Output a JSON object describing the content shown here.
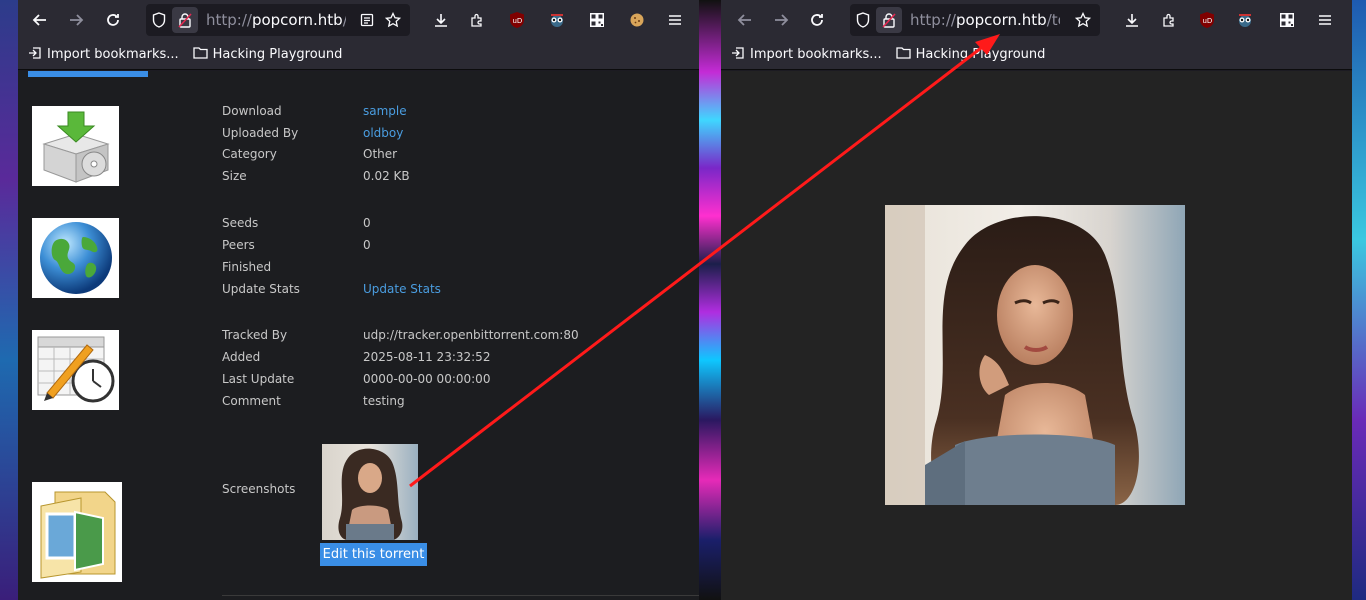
{
  "left_window": {
    "url_prefix": "http://",
    "url_host": "popcorn.htb",
    "url_path": "/t",
    "bookmarks": [
      "Import bookmarks...",
      "Hacking Playground"
    ],
    "details": [
      {
        "label": "Download",
        "value": "sample",
        "link": true
      },
      {
        "label": "Uploaded By",
        "value": "oldboy",
        "link": true
      },
      {
        "label": "Category",
        "value": "Other",
        "link": false
      },
      {
        "label": "Size",
        "value": "0.02 KB",
        "link": false
      }
    ],
    "stats": [
      {
        "label": "Seeds",
        "value": "0",
        "link": false
      },
      {
        "label": "Peers",
        "value": "0",
        "link": false
      },
      {
        "label": "Finished",
        "value": "",
        "link": false
      },
      {
        "label": "Update Stats",
        "value": "Update Stats",
        "link": true
      }
    ],
    "tracking": [
      {
        "label": "Tracked By",
        "value": "udp://tracker.openbittorrent.com:80"
      },
      {
        "label": "Added",
        "value": "2025-08-11 23:32:52"
      },
      {
        "label": "Last Update",
        "value": "0000-00-00 00:00:00"
      },
      {
        "label": "Comment",
        "value": "testing"
      }
    ],
    "screenshots_label": "Screenshots",
    "edit_button": "Edit this torrent"
  },
  "right_window": {
    "url_prefix": "http://",
    "url_host": "popcorn.htb",
    "url_path": "/tor",
    "bookmarks": [
      "Import bookmarks...",
      "Hacking Playground"
    ]
  },
  "colors": {
    "link": "#4a9de0",
    "button": "#3a8ee6",
    "annotation_arrow": "#ff1a1a"
  },
  "icons": [
    "back-arrow-icon",
    "forward-arrow-icon",
    "reload-icon",
    "shield-icon",
    "lock-icon",
    "reader-view-icon",
    "star-icon",
    "download-icon",
    "extensions-icon",
    "ublock-icon",
    "extension-mask-icon",
    "qr-icon",
    "cookie-icon",
    "menu-icon",
    "import-icon",
    "folder-icon"
  ]
}
